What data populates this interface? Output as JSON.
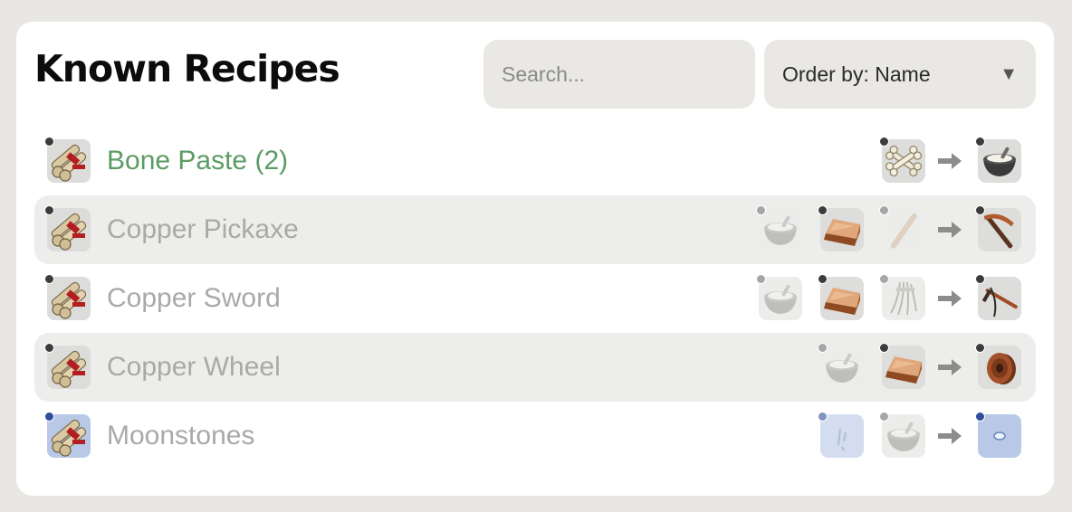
{
  "header": {
    "title": "Known Recipes",
    "search_placeholder": "Search...",
    "order_by_label": "Order by: Name"
  },
  "recipes": [
    {
      "name": "Bone Paste (2)",
      "known": true,
      "ingredients": [
        "bones-icon"
      ],
      "output": "bone-paste-bowl-icon"
    },
    {
      "name": "Copper Pickaxe",
      "known": false,
      "ingredients": [
        "bone-paste-bowl-icon",
        "copper-ingot-icon",
        "stick-icon"
      ],
      "output": "copper-pickaxe-icon"
    },
    {
      "name": "Copper Sword",
      "known": false,
      "ingredients": [
        "bone-paste-bowl-icon",
        "copper-ingot-icon",
        "fiber-icon"
      ],
      "output": "copper-sword-icon"
    },
    {
      "name": "Copper Wheel",
      "known": false,
      "ingredients": [
        "bone-paste-bowl-icon",
        "copper-ingot-icon"
      ],
      "output": "copper-wheel-icon"
    },
    {
      "name": "Moonstones",
      "known": false,
      "ingredients": [
        "moon-shard-icon",
        "bone-paste-bowl-icon"
      ],
      "output": "moonstone-icon"
    }
  ],
  "colors": {
    "background": "#e8e7e3",
    "panel": "#ffffff",
    "known_name": "#5b9b64",
    "unknown_name": "#a9a9a7",
    "row_alt": "#ededec"
  }
}
